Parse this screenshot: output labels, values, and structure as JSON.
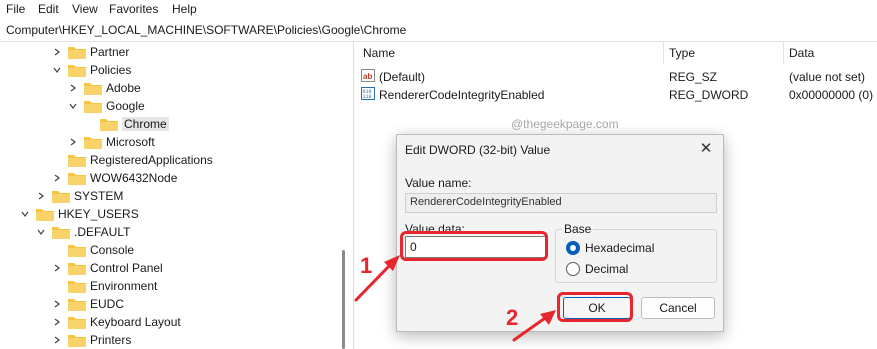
{
  "menu": [
    "File",
    "Edit",
    "View",
    "Favorites",
    "Help"
  ],
  "address": "Computer\\HKEY_LOCAL_MACHINE\\SOFTWARE\\Policies\\Google\\Chrome",
  "tree": [
    {
      "label": "Partner"
    },
    {
      "label": "Policies"
    },
    {
      "label": "Adobe"
    },
    {
      "label": "Google"
    },
    {
      "label": "Chrome"
    },
    {
      "label": "Microsoft"
    },
    {
      "label": "RegisteredApplications"
    },
    {
      "label": "WOW6432Node"
    },
    {
      "label": "SYSTEM"
    },
    {
      "label": "HKEY_USERS"
    },
    {
      "label": ".DEFAULT"
    },
    {
      "label": "Console"
    },
    {
      "label": "Control Panel"
    },
    {
      "label": "Environment"
    },
    {
      "label": "EUDC"
    },
    {
      "label": "Keyboard Layout"
    },
    {
      "label": "Printers"
    }
  ],
  "list": {
    "headers": {
      "name": "Name",
      "type": "Type",
      "data": "Data"
    },
    "rows": [
      {
        "name": "(Default)",
        "type": "REG_SZ",
        "data": "(value not set)",
        "icon": "string-value-icon"
      },
      {
        "name": "RendererCodeIntegrityEnabled",
        "type": "REG_DWORD",
        "data": "0x00000000 (0)",
        "icon": "binary-value-icon"
      }
    ]
  },
  "watermark": "@thegeekpage.com",
  "dialog": {
    "title": "Edit DWORD (32-bit) Value",
    "close": "✕",
    "value_name_label": "Value name:",
    "value_name": "RendererCodeIntegrityEnabled",
    "value_data_label": "Value data:",
    "value_data": "0",
    "base_label": "Base",
    "base_options": [
      {
        "label": "Hexadecimal",
        "selected": true
      },
      {
        "label": "Decimal",
        "selected": false
      }
    ],
    "ok": "OK",
    "cancel": "Cancel"
  },
  "annotations": {
    "step1": "1",
    "step2": "2",
    "color": "#e8262d"
  },
  "colors": {
    "folder": "#f5c544",
    "accent": "#005fb8"
  }
}
